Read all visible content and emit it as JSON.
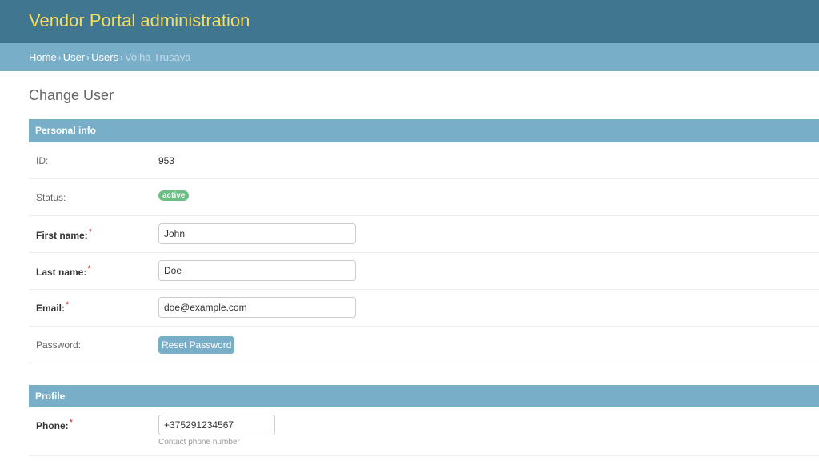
{
  "header": {
    "site_name": "Vendor Portal administration"
  },
  "breadcrumbs": {
    "items": [
      "Home",
      "User",
      "Users"
    ],
    "separator": "›",
    "current": "Volha Trusava"
  },
  "page": {
    "title": "Change User"
  },
  "personal_info": {
    "heading": "Personal info",
    "id_label": "ID:",
    "id_value": "953",
    "status_label": "Status:",
    "status_value": "active",
    "first_name_label": "First name:",
    "first_name_value": "John",
    "last_name_label": "Last name:",
    "last_name_value": "Doe",
    "email_label": "Email:",
    "email_value": "doe@example.com",
    "password_label": "Password:",
    "reset_button": "Reset Password",
    "required_mark": "*"
  },
  "profile": {
    "heading": "Profile",
    "phone_label": "Phone:",
    "phone_value": "+375291234567",
    "phone_help": "Contact phone number"
  },
  "colors": {
    "header_bg": "#417690",
    "site_name": "#f5dd5d",
    "breadcrumbs_bg": "#79aec8",
    "module_head_bg": "#79aec8",
    "badge_active": "#6cbf84",
    "required": "#ba2121"
  }
}
